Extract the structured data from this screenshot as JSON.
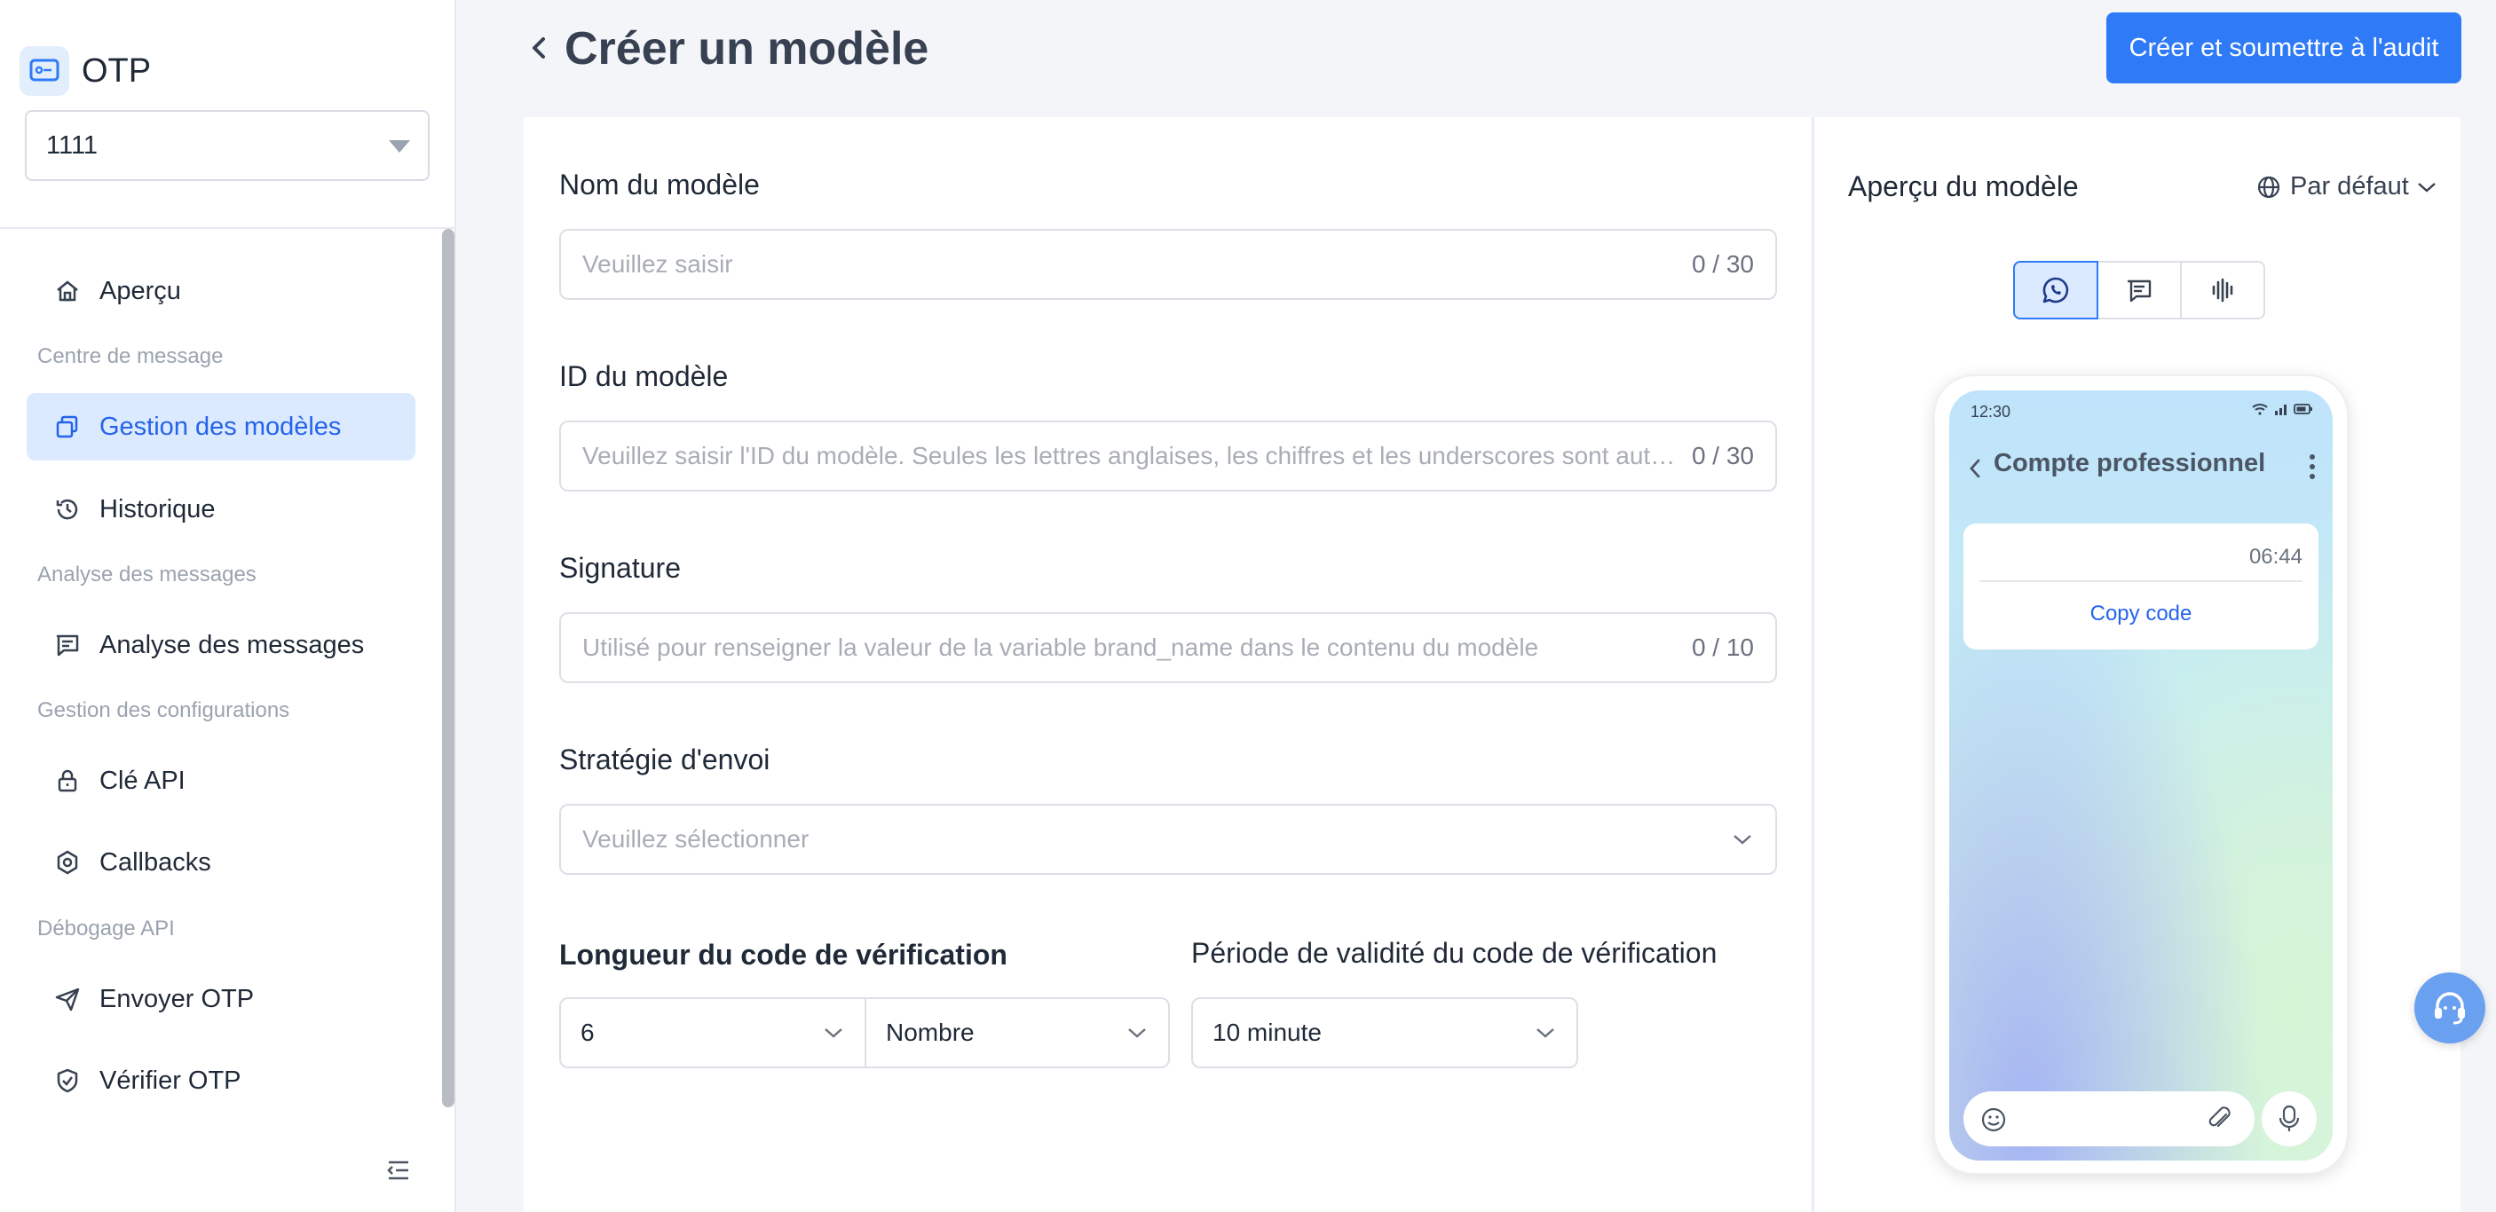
{
  "app": {
    "name": "OTP",
    "project": "1111"
  },
  "sidebar": {
    "items": [
      {
        "label": "Aperçu"
      },
      {
        "group": "Centre de message"
      },
      {
        "label": "Gestion des modèles"
      },
      {
        "label": "Historique"
      },
      {
        "group": "Analyse des messages"
      },
      {
        "label": "Analyse des messages"
      },
      {
        "group": "Gestion des configurations"
      },
      {
        "label": "Clé API"
      },
      {
        "label": "Callbacks"
      },
      {
        "group": "Débogage API"
      },
      {
        "label": "Envoyer OTP"
      },
      {
        "label": "Vérifier OTP"
      }
    ]
  },
  "header": {
    "title": "Créer un modèle",
    "submit_label": "Créer et soumettre à l'audit"
  },
  "form": {
    "name": {
      "label": "Nom du modèle",
      "placeholder": "Veuillez saisir",
      "count": "0 / 30"
    },
    "id": {
      "label": "ID du modèle",
      "placeholder": "Veuillez saisir l'ID du modèle. Seules les lettres anglaises, les chiffres et les underscores sont autorisés",
      "count": "0 / 30"
    },
    "signature": {
      "label": "Signature",
      "placeholder": "Utilisé pour renseigner la valeur de la variable brand_name dans le contenu du modèle",
      "count": "0 / 10"
    },
    "strategy": {
      "label": "Stratégie d'envoi",
      "placeholder": "Veuillez sélectionner"
    },
    "code_length": {
      "label": "Longueur du code de vérification",
      "value": "6",
      "type_value": "Nombre"
    },
    "validity": {
      "label": "Période de validité du code de vérification",
      "value": "10 minute"
    }
  },
  "preview": {
    "title": "Aperçu du modèle",
    "language": "Par défaut",
    "phone": {
      "status_time": "12:30",
      "chat_title": "Compte professionnel",
      "message_time": "06:44",
      "button_label": "Copy code"
    }
  },
  "colors": {
    "accent": "#2f7af6",
    "active_bg": "#dbeafe",
    "active_text": "#2563eb"
  }
}
